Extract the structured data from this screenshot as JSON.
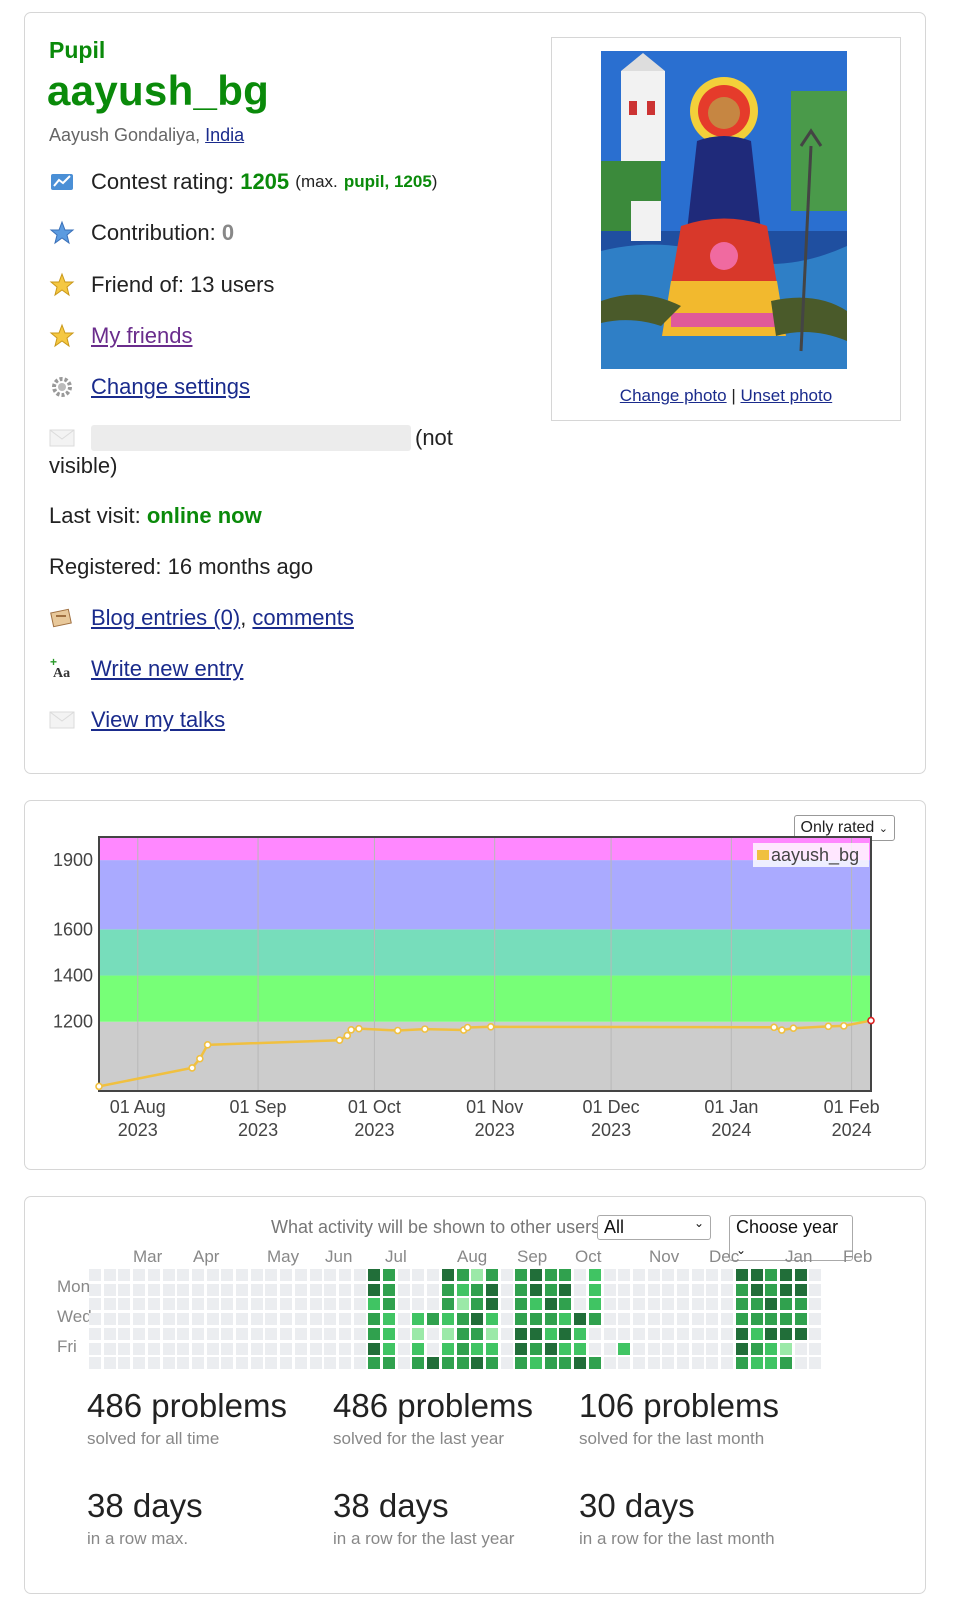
{
  "profile": {
    "rank": "Pupil",
    "handle": "aayush_bg",
    "real_name": "Aayush Gondaliya",
    "country": "India",
    "contest_rating_label": "Contest rating:",
    "contest_rating": "1205",
    "max_prefix": "(max.",
    "max_rank": "pupil, 1205",
    "max_suffix": ")",
    "contribution_label": "Contribution:",
    "contribution": "0",
    "friend_of": "Friend of: 13 users",
    "my_friends": "My friends",
    "change_settings": "Change settings",
    "email_suffix": "(not",
    "email_suffix2": "visible)",
    "last_visit_label": "Last visit:",
    "last_visit": "online now",
    "registered": "Registered: 16 months ago",
    "blog_entries": "Blog entries (0)",
    "comments": "comments",
    "write_entry": "Write new entry",
    "view_talks": "View my talks",
    "change_photo": "Change photo",
    "unset_photo": "Unset photo",
    "photo_separator": "|"
  },
  "chart_filter": "Only rated",
  "chart_data": {
    "type": "line",
    "series": [
      {
        "name": "aayush_bg",
        "color": "#f0c040",
        "points": [
          [
            "2023-07-22",
            920
          ],
          [
            "2023-08-15",
            1000
          ],
          [
            "2023-08-17",
            1040
          ],
          [
            "2023-08-19",
            1100
          ],
          [
            "2023-09-22",
            1120
          ],
          [
            "2023-09-24",
            1140
          ],
          [
            "2023-09-25",
            1165
          ],
          [
            "2023-09-27",
            1170
          ],
          [
            "2023-10-07",
            1162
          ],
          [
            "2023-10-14",
            1168
          ],
          [
            "2023-10-24",
            1164
          ],
          [
            "2023-10-25",
            1175
          ],
          [
            "2023-10-31",
            1178
          ],
          [
            "2024-01-12",
            1176
          ],
          [
            "2024-01-14",
            1164
          ],
          [
            "2024-01-17",
            1172
          ],
          [
            "2024-01-26",
            1180
          ],
          [
            "2024-01-30",
            1182
          ],
          [
            "2024-02-06",
            1205
          ]
        ]
      }
    ],
    "y_ticks": [
      1200,
      1400,
      1600,
      1900
    ],
    "x_ticks": [
      {
        "date": "2023-08-01",
        "line1": "01 Aug",
        "line2": "2023"
      },
      {
        "date": "2023-09-01",
        "line1": "01 Sep",
        "line2": "2023"
      },
      {
        "date": "2023-10-01",
        "line1": "01 Oct",
        "line2": "2023"
      },
      {
        "date": "2023-11-01",
        "line1": "01 Nov",
        "line2": "2023"
      },
      {
        "date": "2023-12-01",
        "line1": "01 Dec",
        "line2": "2023"
      },
      {
        "date": "2024-01-01",
        "line1": "01 Jan",
        "line2": "2024"
      },
      {
        "date": "2024-02-01",
        "line1": "01 Feb",
        "line2": "2024"
      }
    ],
    "x_range": [
      "2023-07-22",
      "2024-02-06"
    ],
    "y_range": [
      900,
      2000
    ],
    "rank_bands": [
      {
        "from": 900,
        "to": 1200,
        "color": "#cccccc"
      },
      {
        "from": 1200,
        "to": 1400,
        "color": "#77ff77"
      },
      {
        "from": 1400,
        "to": 1600,
        "color": "#77ddbb"
      },
      {
        "from": 1600,
        "to": 1900,
        "color": "#aaaaff"
      },
      {
        "from": 1900,
        "to": 2000,
        "color": "#ff88ff"
      }
    ],
    "legend": "top-right",
    "grid": true
  },
  "activity": {
    "question": "What activity will be shown to other users:",
    "visibility": "All",
    "year_select": "Choose year",
    "months": [
      "Mar",
      "Apr",
      "May",
      "Jun",
      "Jul",
      "Aug",
      "Sep",
      "Oct",
      "Nov",
      "Dec",
      "Jan",
      "Feb"
    ],
    "days": [
      "Mon",
      "Wed",
      "Fri"
    ],
    "weeks": [
      "0000000",
      "0000000",
      "0000000",
      "0000000",
      "0000000",
      "0000000",
      "0000000",
      "0000000",
      "0000000",
      "0000000",
      "0000000",
      "0000000",
      "0000000",
      "0000000",
      "0000000",
      "0000000",
      "0000000",
      "0000000",
      "0000000",
      "4423343",
      "3332223",
      "0000000",
      "0002123",
      "0003004",
      "4332123",
      "3213333",
      "1334324",
      "3442123",
      "0000000",
      "3333443",
      "4423432",
      "3343243",
      "3432423",
      "0004224",
      "2223003",
      "0000000",
      "0000020",
      "0000000",
      "0000000",
      "0000000",
      "0000000",
      "0000000",
      "0000000",
      "0000000",
      "4333443",
      "4433232",
      "3343422",
      "4433413",
      "4433400",
      "0000000"
    ],
    "colors": [
      "#ebedf0",
      "#9be9a8",
      "#40c463",
      "#30a14e",
      "#216e39"
    ],
    "stats": [
      {
        "num": "486 problems",
        "lbl": "solved for all time"
      },
      {
        "num": "486 problems",
        "lbl": "solved for the last year"
      },
      {
        "num": "106 problems",
        "lbl": "solved for the last month"
      },
      {
        "num": "38 days",
        "lbl": "in a row max."
      },
      {
        "num": "38 days",
        "lbl": "in a row for the last year"
      },
      {
        "num": "30 days",
        "lbl": "in a row for the last month"
      }
    ]
  }
}
